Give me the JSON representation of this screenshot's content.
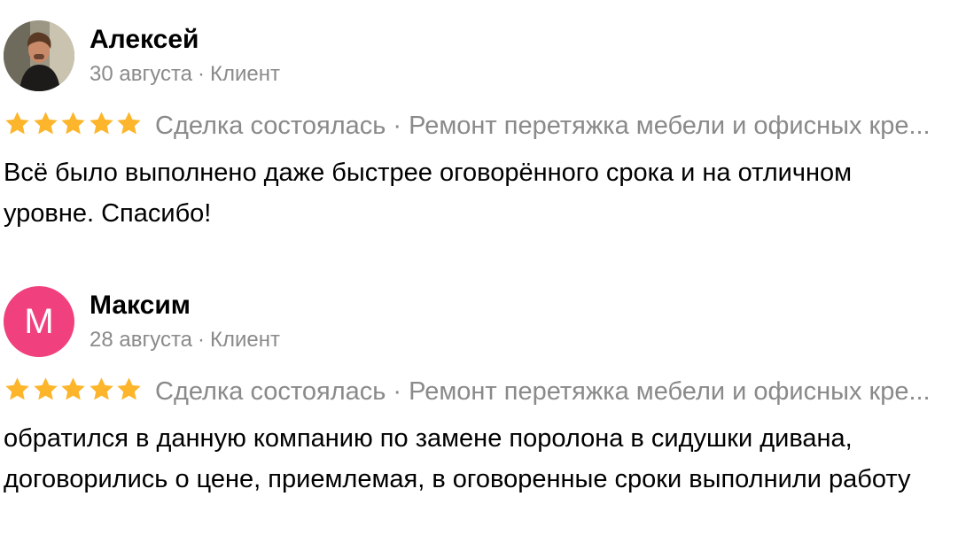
{
  "reviews": [
    {
      "author": "Алексей",
      "date": "30 августа",
      "role": "Клиент",
      "separator": "·",
      "avatar": {
        "type": "photo"
      },
      "rating": 5,
      "deal_status": "Сделка состоялась · Ремонт перетяжка мебели и офисных кре...",
      "text": "Всё было выполнено даже быстрее оговорённого срока и на отличном уровне. Спасибо!"
    },
    {
      "author": "Максим",
      "date": "28 августа",
      "role": "Клиент",
      "separator": "·",
      "avatar": {
        "type": "letter",
        "letter": "М",
        "color": "#f0417e"
      },
      "rating": 5,
      "deal_status": "Сделка состоялась · Ремонт перетяжка мебели и офисных кре...",
      "text_line1": "обратился в данную компанию по замене поролона в сидушки дивана,",
      "text_line2": "договорились о цене, приемлемая, в оговоренные сроки выполнили работу"
    }
  ],
  "colors": {
    "star": "#fdb52b",
    "muted_text": "#8a8a8a",
    "avatar_pink": "#f0417e"
  }
}
